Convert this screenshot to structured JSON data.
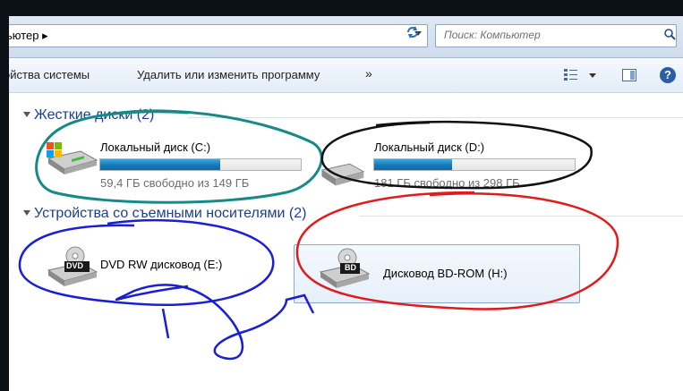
{
  "address": {
    "path": "ьютер",
    "separator": "▸"
  },
  "search": {
    "placeholder": "Поиск: Компьютер"
  },
  "toolbar": {
    "system_properties": "ойства системы",
    "uninstall": "Удалить или изменить программу",
    "more": "»"
  },
  "groups": [
    {
      "title": "Жесткие диски (2)",
      "drives": [
        {
          "name": "Локальный диск (C:)",
          "free": "59,4 ГБ свободно из 149 ГБ",
          "used_fraction": 0.6
        },
        {
          "name": "Локальный диск (D:)",
          "free": "181 ГБ свободно из 298 ГБ",
          "used_fraction": 0.39
        }
      ]
    },
    {
      "title": "Устройства со съемными носителями (2)",
      "drives": [
        {
          "name": "DVD RW дисковод (E:)",
          "label": "DVD"
        },
        {
          "name": "Дисковод BD-ROM (H:)",
          "label": "BD"
        }
      ]
    }
  ],
  "colors": {
    "bar_fill": "#1579b8",
    "group_header": "#1e3f8a",
    "annotation_teal": "#168a86",
    "annotation_black": "#111111",
    "annotation_red": "#e01b1b",
    "annotation_blue": "#1a1fd6"
  }
}
